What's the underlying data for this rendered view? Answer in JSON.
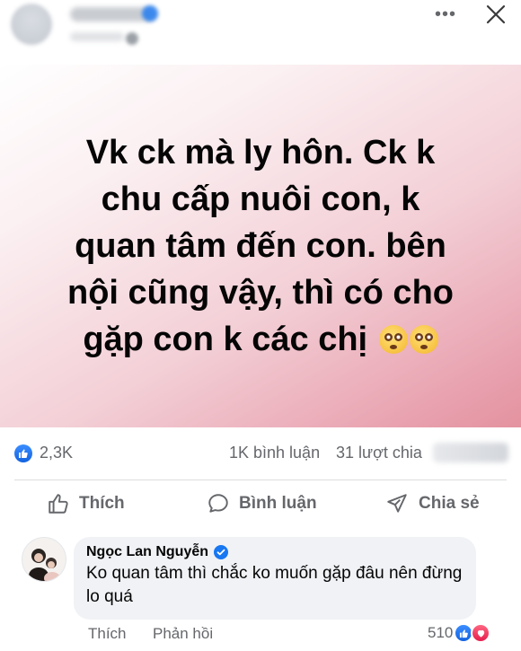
{
  "header": {
    "more_icon": "more-horizontal-icon",
    "close_icon": "close-icon",
    "more_label": "•••"
  },
  "post": {
    "text_lines": [
      "Vk ck mà ly hôn. Ck k",
      "chu cấp nuôi con, k",
      "quan tâm đến con. bên",
      "nội cũng vậy, thì có cho",
      "gặp con k các chị"
    ],
    "emoji": "flushed-face-emoji",
    "background_colors": [
      "#ffffff",
      "#f3cfd6",
      "#e4929f"
    ]
  },
  "stats": {
    "like_count": "2,3K",
    "comments": "1K bình luận",
    "shares": "31 lượt chia"
  },
  "actions": {
    "like": "Thích",
    "comment": "Bình luận",
    "share": "Chia sẻ"
  },
  "comment": {
    "author": "Ngọc Lan Nguyễn",
    "verified": true,
    "text": "Ko quan tâm thì chắc ko muốn gặp đâu nên đừng lo quá",
    "like": "Thích",
    "reply": "Phản hồi",
    "reaction_count": "510",
    "reactions": [
      "like",
      "love"
    ]
  },
  "colors": {
    "brand_blue": "#1877f2",
    "secondary_text": "#65676b",
    "comment_bubble": "#f0f2f5"
  }
}
